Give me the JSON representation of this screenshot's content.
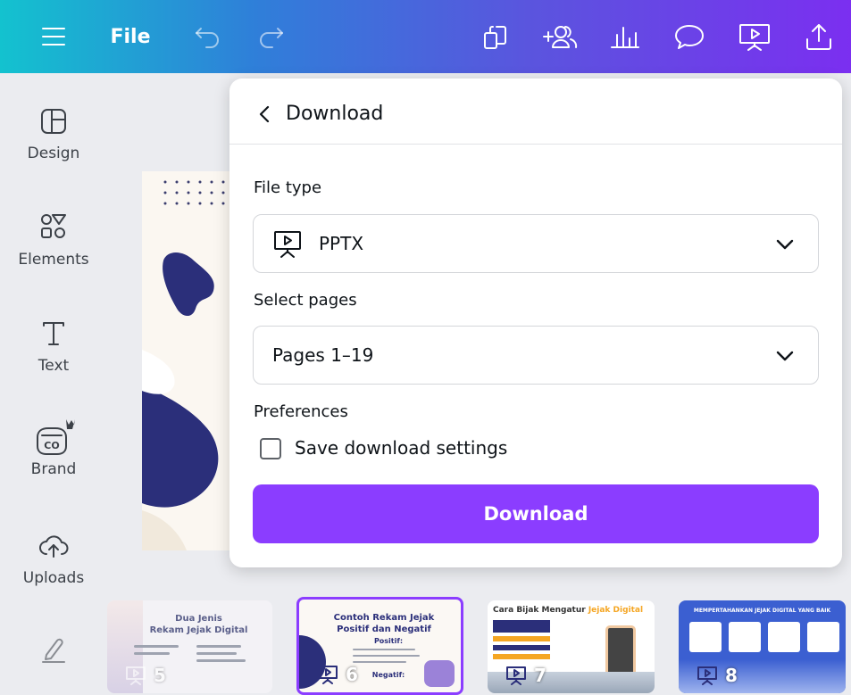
{
  "topbar": {
    "file_label": "File",
    "icons": [
      "menu-icon",
      "undo-icon",
      "redo-icon",
      "resize-icon",
      "add-people-icon",
      "insights-icon",
      "comment-icon",
      "present-icon",
      "share-icon"
    ]
  },
  "sidebar": {
    "items": [
      {
        "label": "Design",
        "icon": "design-icon"
      },
      {
        "label": "Elements",
        "icon": "elements-icon"
      },
      {
        "label": "Text",
        "icon": "text-icon"
      },
      {
        "label": "Brand",
        "icon": "brand-icon"
      },
      {
        "label": "Uploads",
        "icon": "uploads-icon"
      },
      {
        "label": "",
        "icon": "draw-icon"
      }
    ]
  },
  "download_panel": {
    "title": "Download",
    "file_type_label": "File type",
    "file_type_value": "PPTX",
    "select_pages_label": "Select pages",
    "select_pages_value": "Pages 1–19",
    "preferences_label": "Preferences",
    "save_settings_label": "Save download settings",
    "save_settings_checked": false,
    "download_button": "Download"
  },
  "thumbnails": [
    {
      "number": "5",
      "title_line1": "Dua Jenis",
      "title_line2": "Rekam Jejak Digital"
    },
    {
      "number": "6",
      "title_line1": "Contoh Rekam Jejak",
      "title_line2": "Positif dan Negatif",
      "sub1": "Positif:",
      "sub2": "Negatif:",
      "selected": true
    },
    {
      "number": "7",
      "title_prefix": "Cara Bijak Mengatur ",
      "title_highlight": "Jejak Digital"
    },
    {
      "number": "8",
      "title_line1": "MEMPERTAHANKAN JEJAK DIGITAL YANG BAIK"
    }
  ],
  "colors": {
    "accent": "#8b3dff",
    "topbar_gradient_start": "#13c2cf",
    "topbar_gradient_end": "#7b2ff0",
    "slide_navy": "#2b2f7a"
  }
}
